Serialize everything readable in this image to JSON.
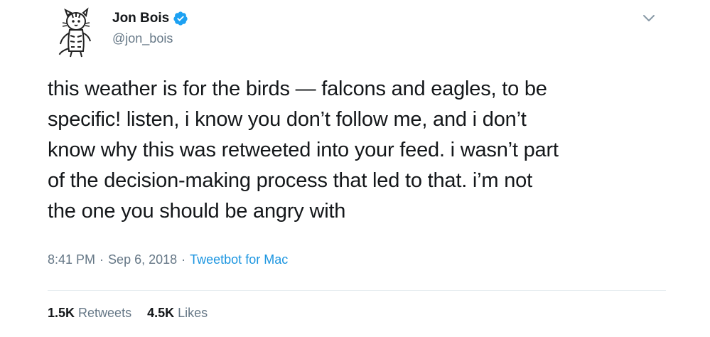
{
  "tweet": {
    "author": {
      "display_name": "Jon Bois",
      "handle": "@jon_bois",
      "verified": true,
      "avatar_icon": "cartoon-tiger-avatar-icon"
    },
    "menu_icon": "chevron-down-icon",
    "text_lines": [
      "this weather is for the birds — falcons and eagles, to be",
      "specific! listen, i know you don’t follow me, and i don’t",
      "know why this was retweeted into your feed. i wasn’t part",
      "of the decision-making process that led to that. i’m not",
      "the one you should be angry with"
    ],
    "meta": {
      "time": "8:41 PM",
      "separator": "·",
      "date": "Sep 6, 2018",
      "source": "Tweetbot for Mac"
    },
    "stats": {
      "retweets_count": "1.5K",
      "retweets_label": "Retweets",
      "likes_count": "4.5K",
      "likes_label": "Likes"
    }
  },
  "colors": {
    "text_primary": "#14171a",
    "text_secondary": "#657786",
    "link_blue": "#1b95e0",
    "verified_blue": "#1da1f2",
    "divider": "#e6ecf0"
  }
}
